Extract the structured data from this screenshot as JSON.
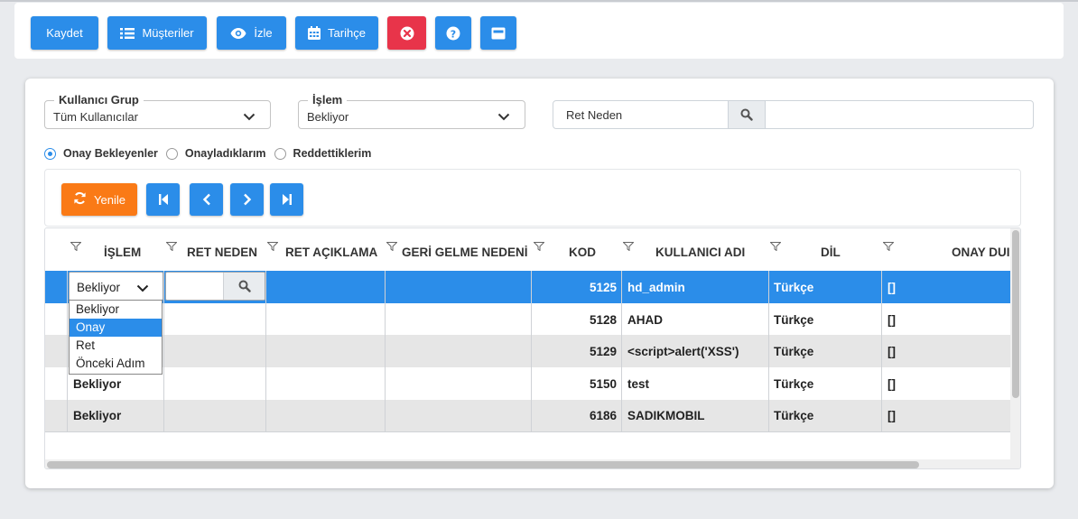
{
  "toolbar": {
    "save_label": "Kaydet",
    "customers_label": "Müşteriler",
    "watch_label": "İzle",
    "history_label": "Tarihçe",
    "colors": {
      "primary": "#2b8de9",
      "danger": "#e8344a"
    }
  },
  "filters": {
    "group": {
      "label": "Kullanıcı Grup",
      "value": "Tüm Kullanıcılar"
    },
    "process": {
      "label": "İşlem",
      "value": "Bekliyor"
    },
    "reject_reason": {
      "label": "Ret Neden"
    }
  },
  "radios": [
    {
      "label": "Onay Bekleyenler",
      "checked": true
    },
    {
      "label": "Onayladıklarım",
      "checked": false
    },
    {
      "label": "Reddettiklerim",
      "checked": false
    }
  ],
  "nav": {
    "refresh_label": "Yenile",
    "refresh_color": "#fa7a16"
  },
  "grid": {
    "columns": [
      "İŞLEM",
      "RET NEDEN",
      "RET AÇIKLAMA",
      "GERİ GELME NEDENİ",
      "KOD",
      "KULLANICI ADI",
      "DİL",
      "ONAY DUI"
    ],
    "edit_select_value": "Bekliyor",
    "dropdown_options": [
      "Bekliyor",
      "Onay",
      "Ret",
      "Önceki Adım"
    ],
    "dropdown_highlighted": "Onay",
    "rows": [
      {
        "islem": "",
        "kod": "5125",
        "kullanici": "hd_admin",
        "dil": "Türkçe",
        "onay": "[]",
        "selected": true
      },
      {
        "islem": "",
        "kod": "5128",
        "kullanici": "AHAD",
        "dil": "Türkçe",
        "onay": "[]"
      },
      {
        "islem": "",
        "kod": "5129",
        "kullanici": "<script>alert('XSS')",
        "dil": "Türkçe",
        "onay": "[]"
      },
      {
        "islem": "Bekliyor",
        "kod": "5150",
        "kullanici": "test",
        "dil": "Türkçe",
        "onay": "[]"
      },
      {
        "islem": "Bekliyor",
        "kod": "6186",
        "kullanici": "SADIKMOBIL",
        "dil": "Türkçe",
        "onay": "[]"
      }
    ]
  }
}
